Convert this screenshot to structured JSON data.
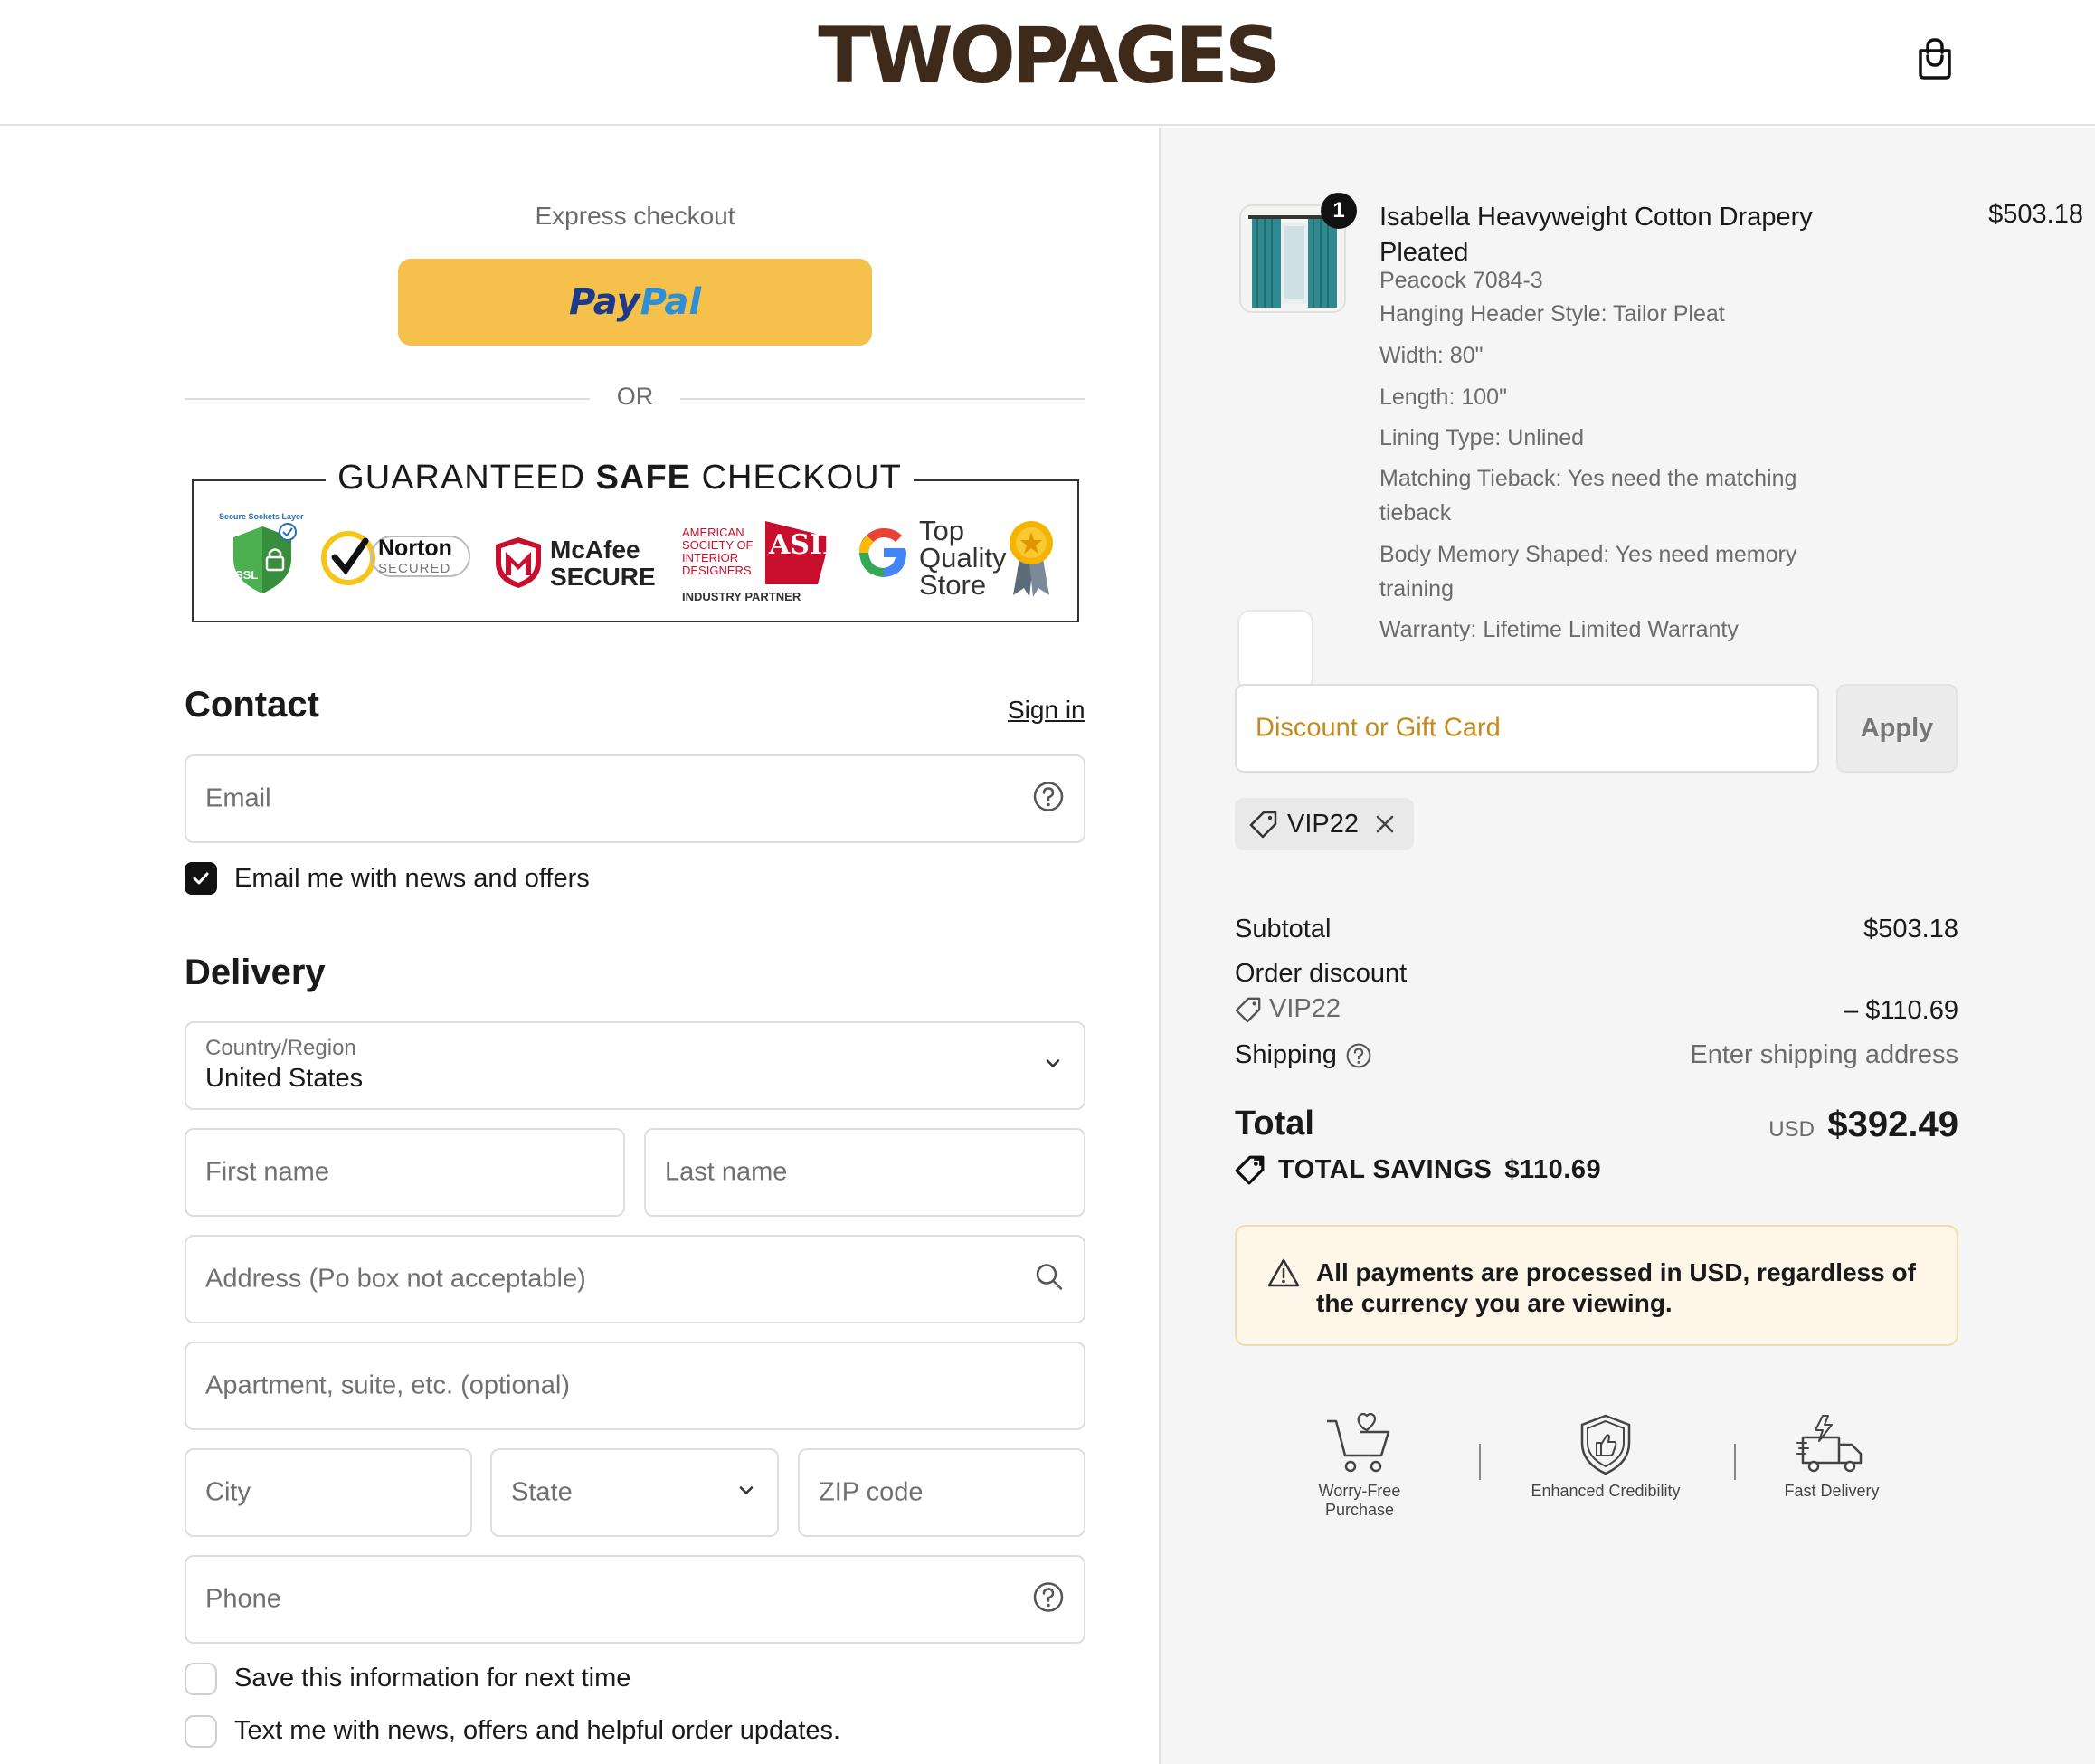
{
  "header": {
    "logo": "TWOPAGES",
    "cart_icon": "shopping-bag-icon"
  },
  "express": {
    "title": "Express checkout",
    "paypal_pay": "Pay",
    "paypal_pal": "Pal",
    "or_label": "OR"
  },
  "badge": {
    "title_pre": "GUARANTEED ",
    "title_bold": "SAFE",
    "title_post": " CHECKOUT",
    "ssl_caption": "Secure Sockets Layer",
    "ssl_label": "SSL",
    "norton_name": "Norton",
    "norton_sub": "SECURED",
    "mcafee_name": "McAfee",
    "mcafee_sub": "SECURE",
    "asid_line1": "AMERICAN",
    "asid_line2": "SOCIETY OF",
    "asid_line3": "INTERIOR",
    "asid_line4": "DESIGNERS",
    "asid_partner": "INDUSTRY PARTNER",
    "asid_mark": "ASID",
    "google_line1": "Top",
    "google_line2": "Quality",
    "google_line3": "Store"
  },
  "contact": {
    "title": "Contact",
    "sign_in": "Sign in",
    "email_placeholder": "Email",
    "news_checkbox_label": "Email me with news and offers",
    "news_checked": true
  },
  "delivery": {
    "title": "Delivery",
    "country_label": "Country/Region",
    "country_value": "United States",
    "first_name_placeholder": "First name",
    "last_name_placeholder": "Last name",
    "address_placeholder": "Address (Po box not acceptable)",
    "apartment_placeholder": "Apartment, suite, etc. (optional)",
    "city_placeholder": "City",
    "state_placeholder": "State",
    "zip_placeholder": "ZIP code",
    "phone_placeholder": "Phone",
    "save_info_label": "Save this information for next time",
    "text_me_label": "Text me with news, offers and helpful order updates."
  },
  "order": {
    "product": {
      "quantity": "1",
      "name": "Isabella Heavyweight Cotton Drapery Pleated",
      "price": "$503.18",
      "variant": "Peacock 7084-3",
      "options": [
        "Hanging Header Style: Tailor Pleat",
        "Width: 80\"",
        "Length: 100\"",
        "Lining Type: Unlined",
        "Matching Tieback: Yes need the matching tieback",
        "Body Memory Shaped: Yes need memory training",
        "Warranty: Lifetime Limited Warranty"
      ]
    },
    "discount_placeholder": "Discount or Gift Card",
    "apply_label": "Apply",
    "applied_code": "VIP22",
    "subtotal_label": "Subtotal",
    "subtotal_value": "$503.18",
    "order_discount_label": "Order discount",
    "order_discount_code": "VIP22",
    "order_discount_value": "– $110.69",
    "shipping_label": "Shipping",
    "shipping_value": "Enter shipping address",
    "total_label": "Total",
    "total_currency": "USD",
    "total_value": "$392.49",
    "savings_label": "TOTAL SAVINGS",
    "savings_value": "$110.69",
    "notice": "All payments are processed in USD, regardless of the currency you are viewing.",
    "trust": [
      {
        "label": "Worry-Free Purchase",
        "icon": "cart-heart-icon"
      },
      {
        "label": "Enhanced Credibility",
        "icon": "shield-thumbs-up-icon"
      },
      {
        "label": "Fast Delivery",
        "icon": "delivery-truck-icon"
      }
    ]
  },
  "colors": {
    "paypal_button": "#f6c14a",
    "paypal_dark_blue": "#1d3a8a",
    "paypal_light_blue": "#2d8fd8",
    "logo_brown": "#3d2a1a",
    "discount_placeholder": "#c58a1b",
    "notice_background": "#fdf6e9",
    "right_panel_background": "#f5f5f5"
  }
}
